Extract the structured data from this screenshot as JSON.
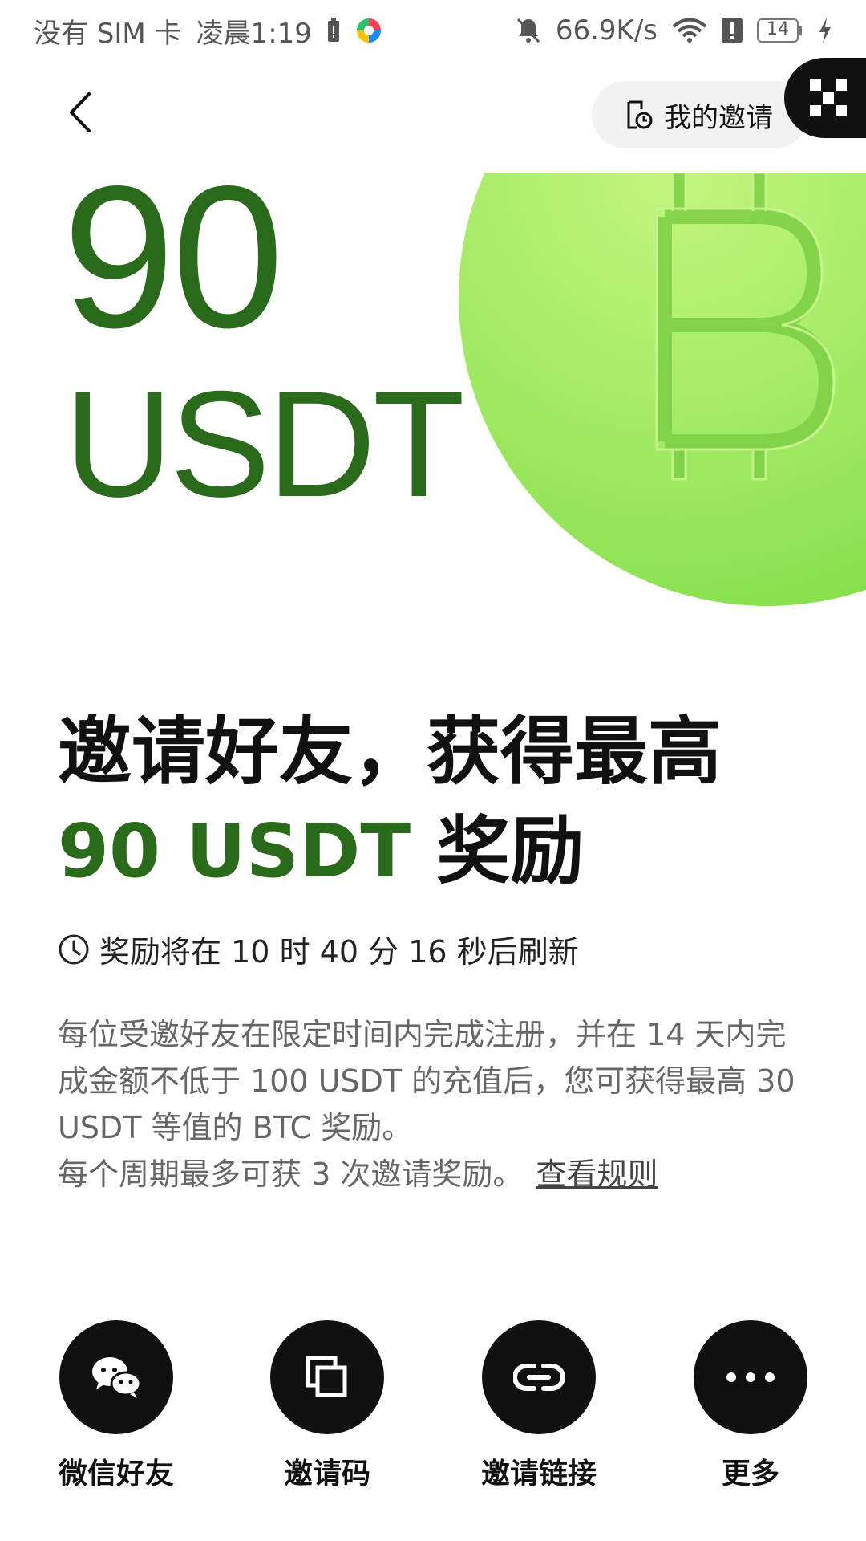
{
  "status_bar": {
    "carrier": "没有 SIM 卡",
    "time": "凌晨1:19",
    "net_speed": "66.9K/s",
    "battery": "14"
  },
  "header": {
    "my_invites_label": "我的邀请"
  },
  "hero": {
    "amount": "90",
    "unit": "USDT"
  },
  "title": {
    "line1": "邀请好友，获得最高",
    "amount_text": "90 USDT",
    "suffix": "奖励"
  },
  "countdown": {
    "prefix": "奖励将在",
    "hours": "10",
    "hours_unit": "时",
    "minutes": "40",
    "minutes_unit": "分",
    "seconds": "16",
    "seconds_unit": "秒后刷新"
  },
  "description": {
    "text": "每位受邀好友在限定时间内完成注册，并在 14 天内完成金额不低于 100 USDT 的充值后，您可获得最高 30 USDT 等值的 BTC 奖励。",
    "cycle_text": "每个周期最多可获 3 次邀请奖励。",
    "rules_link": "查看规则"
  },
  "share_options": [
    {
      "label": "微信好友",
      "icon": "wechat-icon"
    },
    {
      "label": "邀请码",
      "icon": "copy-icon"
    },
    {
      "label": "邀请链接",
      "icon": "link-icon"
    },
    {
      "label": "更多",
      "icon": "more-icon"
    }
  ],
  "colors": {
    "brand_green": "#2a6b1b",
    "coin_green": "#a6ec67",
    "dark": "#111111"
  }
}
